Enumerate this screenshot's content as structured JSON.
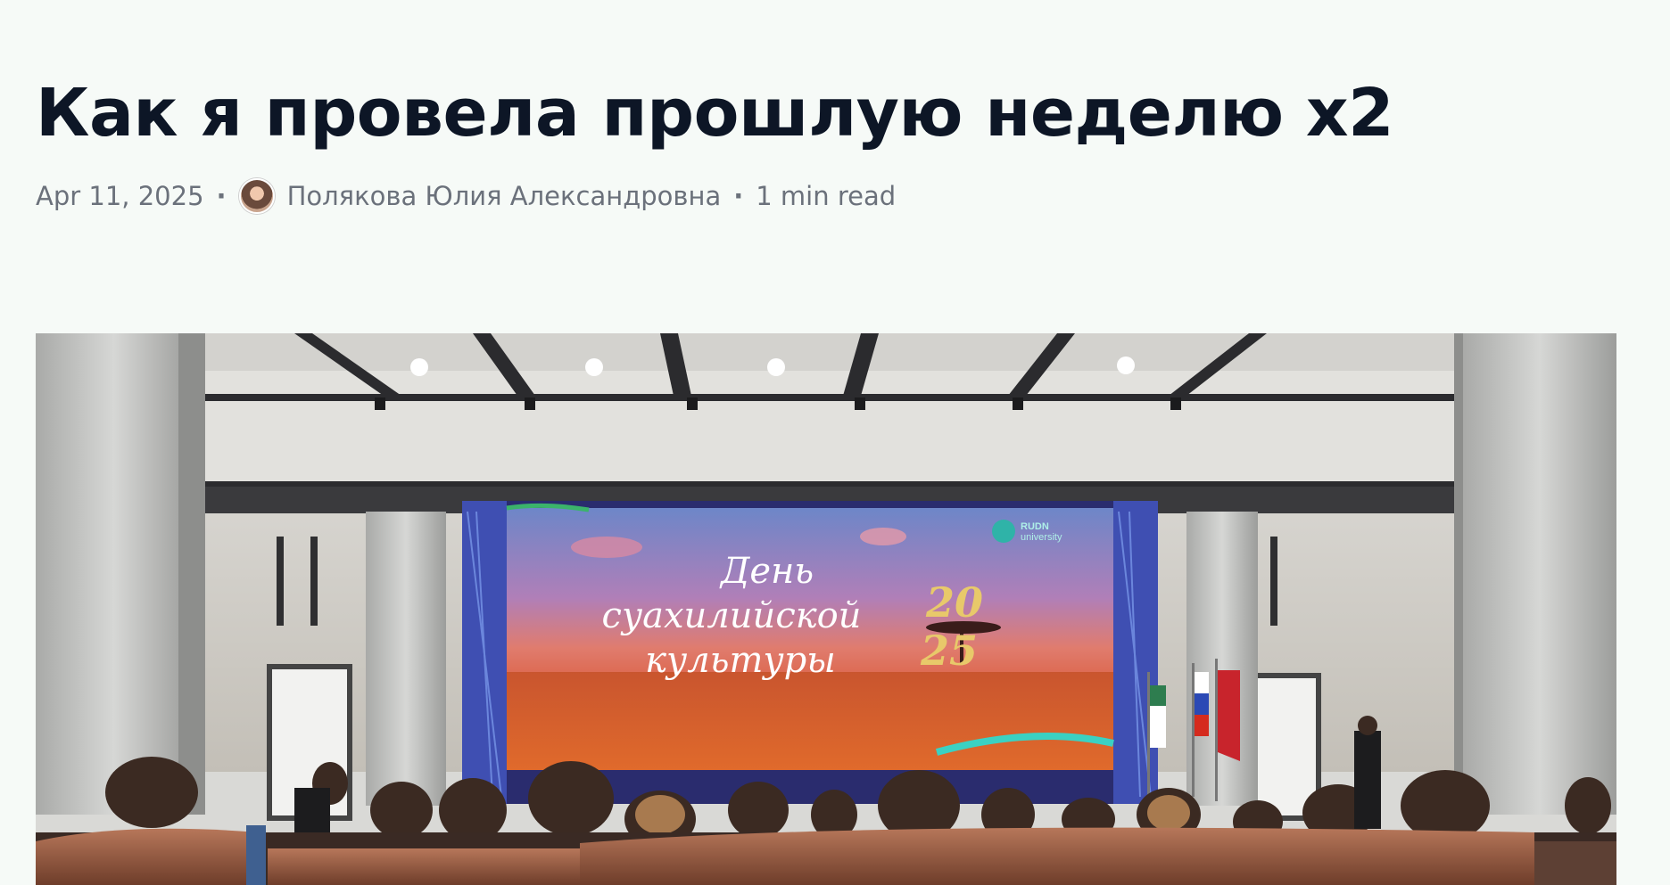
{
  "article": {
    "title": "Как я провела прошлую неделю x2",
    "date": "Apr 11, 2025",
    "separator": "·",
    "author": "Полякова Юлия Александровна",
    "read_time": "1 min read"
  },
  "hero_image": {
    "screen_title_line1": "День",
    "screen_title_line2": "суахилийской",
    "screen_title_line3": "культуры",
    "screen_year_top": "20",
    "screen_year_bottom": "25",
    "logo_text_1": "RUDN",
    "logo_text_2": "university"
  },
  "colors": {
    "background": "#f6faf7",
    "title": "#0d1626",
    "meta": "#6b717b"
  }
}
